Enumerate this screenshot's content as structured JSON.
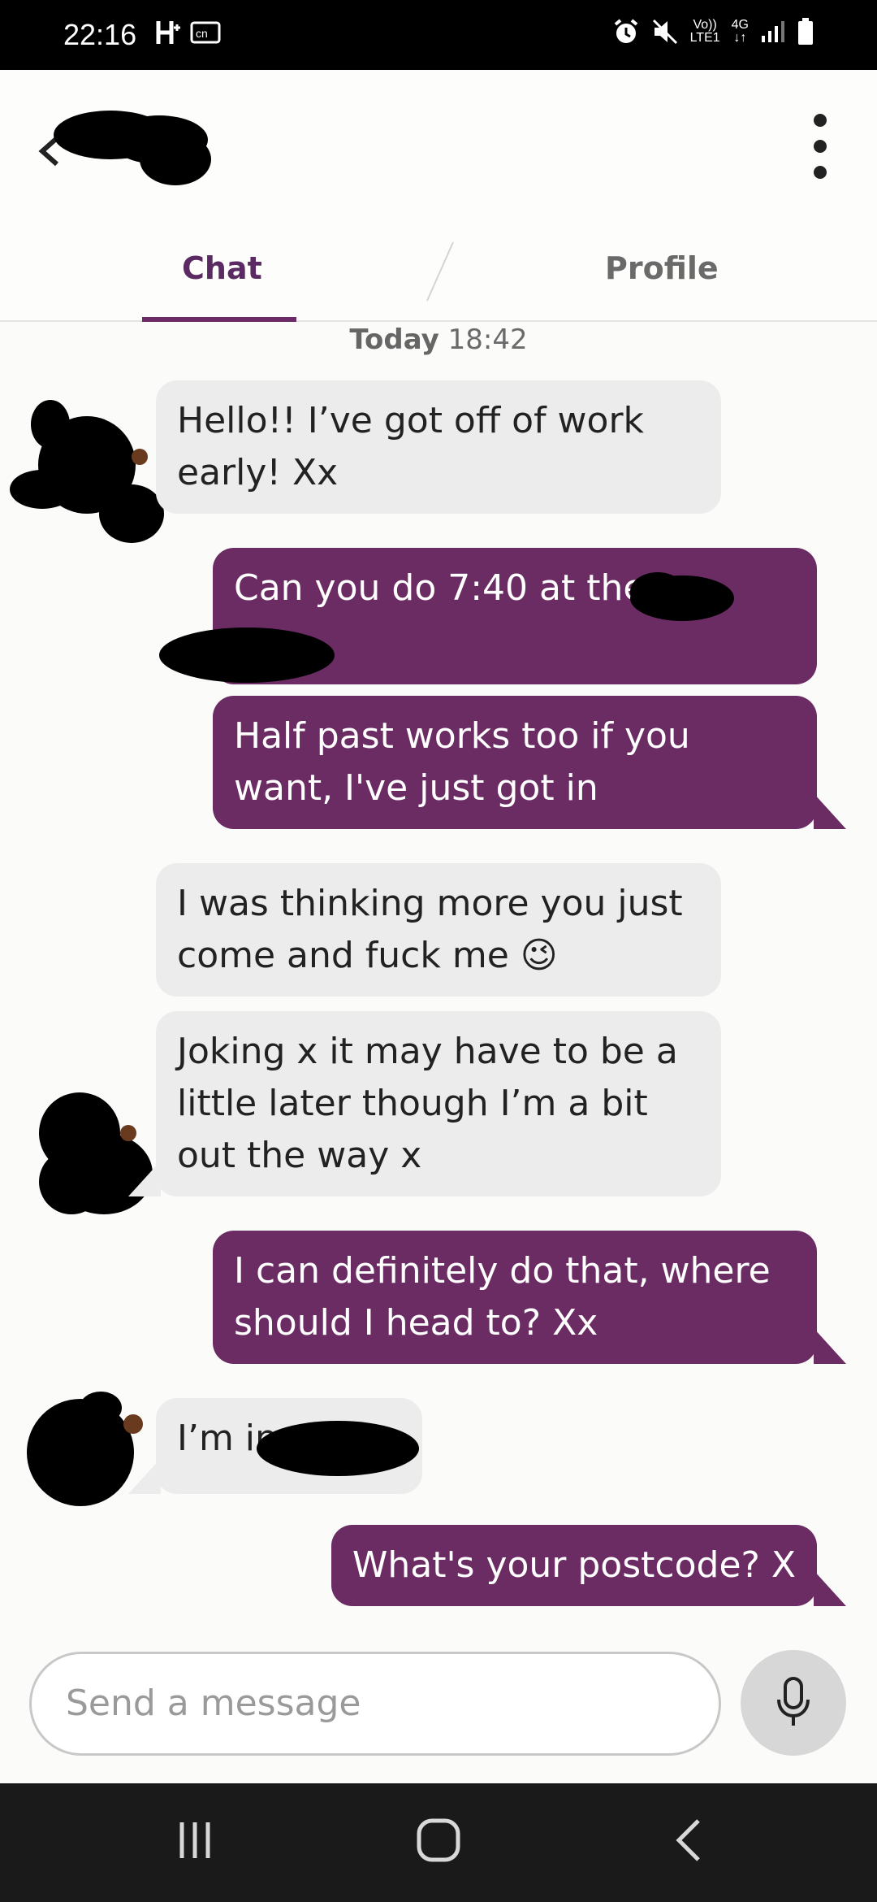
{
  "status_bar": {
    "time": "22:16",
    "network_top": "Vo))",
    "network_bottom": "LTE1",
    "data_type": "4G"
  },
  "header": {
    "tabs": [
      {
        "label": "Chat",
        "active": true
      },
      {
        "label": "Profile",
        "active": false
      }
    ]
  },
  "chat": {
    "date_day": "Today",
    "date_time": "18:42",
    "messages": [
      {
        "direction": "incoming",
        "text": "Hello!! I’ve got off of work early! Xx"
      },
      {
        "direction": "outgoing",
        "text": "Can you do 7:40 at the"
      },
      {
        "direction": "outgoing",
        "text": "Half past works too if you want, I've just got in"
      },
      {
        "direction": "incoming",
        "text": "I was thinking more you just come and fuck me 😉"
      },
      {
        "direction": "incoming",
        "text": "Joking x it may have to be a little later though I’m a bit out the way x"
      },
      {
        "direction": "outgoing",
        "text": "I can definitely do that, where should I head to? Xx"
      },
      {
        "direction": "incoming",
        "text": "I’m in"
      },
      {
        "direction": "outgoing",
        "text": "What's your postcode? X"
      }
    ]
  },
  "composer": {
    "placeholder": "Send a message"
  },
  "colors": {
    "accent": "#6b2b63",
    "incoming_bubble": "#ececec",
    "tab_active": "#5c2a63"
  }
}
